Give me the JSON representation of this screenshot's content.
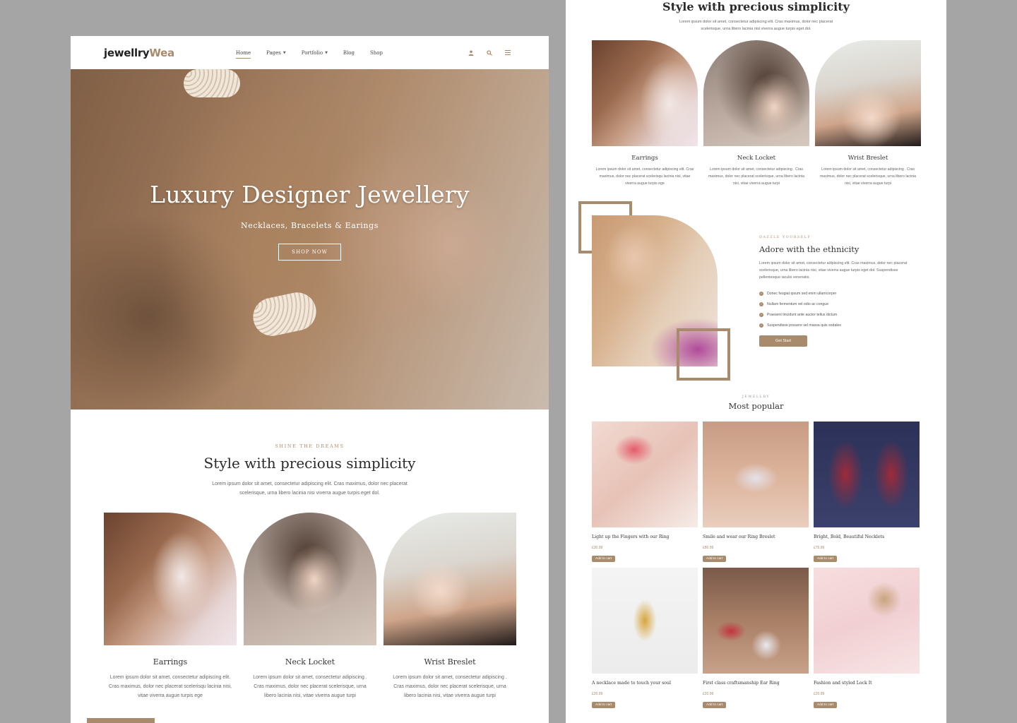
{
  "brand": {
    "name_primary": "jewellry",
    "name_accent": "Wea",
    "accent_color": "#a88a6c"
  },
  "nav": {
    "items": [
      {
        "label": "Home",
        "active": true,
        "has_dropdown": false
      },
      {
        "label": "Pages",
        "active": false,
        "has_dropdown": true
      },
      {
        "label": "Portfolio",
        "active": false,
        "has_dropdown": true
      },
      {
        "label": "Blog",
        "active": false,
        "has_dropdown": false
      },
      {
        "label": "Shop",
        "active": false,
        "has_dropdown": false
      }
    ],
    "icons": [
      "user-icon",
      "search-icon",
      "hamburger-menu-icon"
    ]
  },
  "hero": {
    "title": "Luxury Designer Jewellery",
    "subtitle": "Necklaces, Bracelets & Earings",
    "button": "SHOP NOW"
  },
  "style_section": {
    "kicker": "SHINE THE DREAMS",
    "title": "Style with precious simplicity",
    "text": "Lorem ipsum dolor sit amet, consectetur adipiscing elit. Cras maximus, dolor nec placerat scelerisque, urna libero lacinia nisi viverra augue turpis eget dol.",
    "cards": [
      {
        "title": "Earrings",
        "text": "Lorem ipsum dolor sit amet, consectetur adipiscing elit. Cras maximus, dolor nec placerat scelerisqu lacinia nisi, vitae viverra augue turpis ege"
      },
      {
        "title": "Neck Locket",
        "text": "Lorem ipsum dolor sit amet, consectetur adipiscing . Cras maximus, dolor nec placerat scelerisque, urna libero lacinia nisi, vitae viverra augue turpi"
      },
      {
        "title": "Wrist Breslet",
        "text": "Lorem ipsum dolor sit amet, consectetur adipiscing . Cras maximus, dolor nec placerat scelerisque, urna libero lacinia nisi, vitae viverra augue turpi"
      }
    ]
  },
  "right_style_section": {
    "title": "Style with precious simplicity",
    "text": "Lorem ipsum dolor sit amet, consectetur adipiscing elit. Cras maximus, dolor nec placerat scelerisque, urna libero lacinia nisi viverra augue turpis eget dol.",
    "cards": [
      {
        "title": "Earrings",
        "text": "Lorem ipsum dolor sit amet, consectetur adipiscing elit. Cras maximus, dolor nec placerat scelerisqu lacinia nisi, vitae viverra augue turpis ege"
      },
      {
        "title": "Neck Locket",
        "text": "Lorem ipsum dolor sit amet, consectetur adipiscing . Cras maximus, dolor nec placerat scelerisque, urna libero lacinia nisi, vitae viverra augue turpi"
      },
      {
        "title": "Wrist Breslet",
        "text": "Lorem ipsum dolor sit amet, consectetur adipiscing . Cras maximus, dolor nec placerat scelerisque, urna libero lacinia nisi, vitae viverra augue turpi"
      }
    ]
  },
  "dazzle": {
    "kicker": "DAZZLE YOURSELF",
    "title": "Adore with the ethnicity",
    "text": "Lorem ipsum dolor sit amet, consectetur adipiscing elit. Cras maximus, dolor nec placerat scelerisque, urna libero lacinia nisi, vitae viverra augue turpis eget dol. Suspendisse pellentesque iaculis venenatis.",
    "list": [
      "Donec feugiat ipsum sed enim ullamcorper",
      "Nullam fermentum vel odio ac congue",
      "Praesent tincidunt ante auctor tellus dictum",
      "Suspendisse posuere vel massa quis sodales"
    ],
    "button": "Get Start"
  },
  "popular": {
    "kicker": "JEWELLRY",
    "title": "Most popular",
    "cart_label": "Add to cart",
    "products": [
      {
        "name": "Light up the Fingers with our Ring",
        "price": "£30.99"
      },
      {
        "name": "Smile and wear our Ring Breslet",
        "price": "£80.99"
      },
      {
        "name": "Bright, Bold, Beautiful Necklets",
        "price": "£75.99"
      },
      {
        "name": "A necklace made to touch your soul",
        "price": "£20.99"
      },
      {
        "name": "First class craftsmanship Ear Ring",
        "price": "£20.99"
      },
      {
        "name": "Fashion and styled Lock It",
        "price": "£20.99"
      }
    ]
  }
}
